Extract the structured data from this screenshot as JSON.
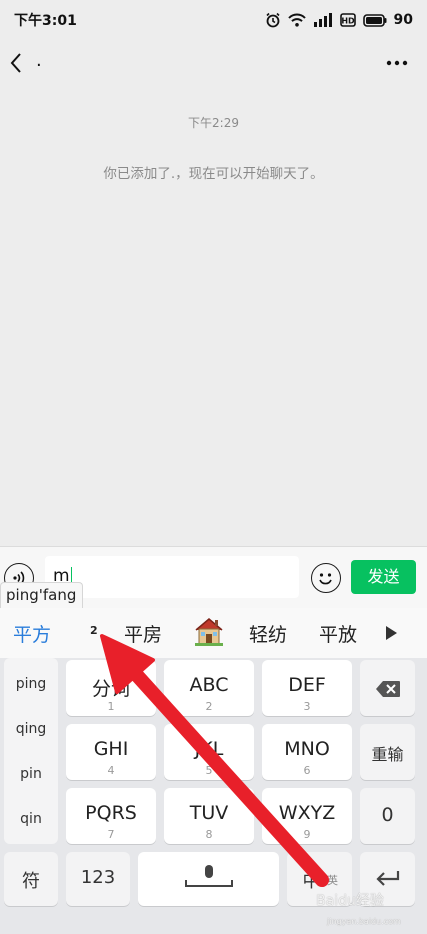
{
  "status_bar": {
    "time": "下午3:01",
    "battery": "90"
  },
  "nav": {
    "title": "."
  },
  "chat": {
    "time": "下午2:29",
    "system_message": "你已添加了.，现在可以开始聊天了。"
  },
  "input": {
    "value": "m",
    "send_label": "发送"
  },
  "candidates": {
    "pinyin": "ping'fang",
    "items": [
      "平方",
      "平房",
      "轻纺",
      "平放"
    ],
    "index_hint": "2",
    "emoji_name": "house-emoji"
  },
  "keyboard": {
    "pinyin_options": [
      "ping",
      "qing",
      "pin",
      "qin"
    ],
    "keys": [
      {
        "main": "分词",
        "sub": "1"
      },
      {
        "main": "ABC",
        "sub": "2"
      },
      {
        "main": "DEF",
        "sub": "3"
      },
      {
        "main": "GHI",
        "sub": "4"
      },
      {
        "main": "JKL",
        "sub": "5"
      },
      {
        "main": "MNO",
        "sub": "6"
      },
      {
        "main": "PQRS",
        "sub": "7"
      },
      {
        "main": "TUV",
        "sub": "8"
      },
      {
        "main": "WXYZ",
        "sub": "9"
      }
    ],
    "reenter_label": "重输",
    "zero_label": "0",
    "symbol_label": "符",
    "number_label": "123",
    "lang_label": "中",
    "lang_sub": "英"
  },
  "watermark": {
    "text": "Baidu经验",
    "url": "jingyan.baidu.com"
  },
  "colors": {
    "accent": "#07c160",
    "candidate_highlight": "#2a7ddb",
    "arrow": "#e8202a"
  }
}
